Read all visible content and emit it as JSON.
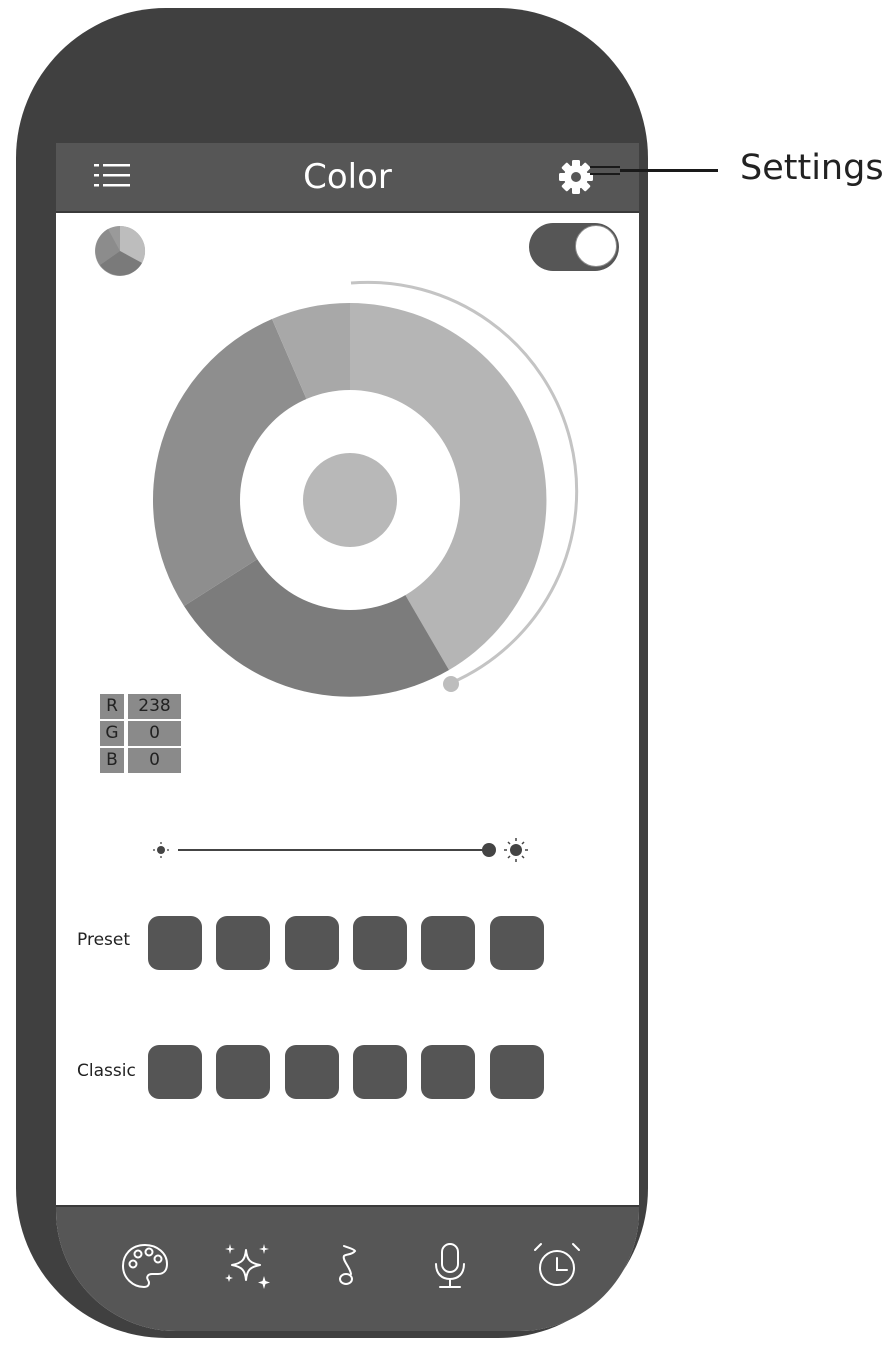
{
  "header": {
    "title": "Color"
  },
  "icons": {
    "menu": "list-menu-icon",
    "settings": "gear-icon",
    "tabs": [
      "palette-icon",
      "sparkles-icon",
      "music-note-icon",
      "microphone-icon",
      "alarm-clock-icon"
    ]
  },
  "power": {
    "state": "on"
  },
  "rgb": {
    "r_label": "R",
    "r": "238",
    "g_label": "G",
    "g": "0",
    "b_label": "B",
    "b": "0"
  },
  "brightness": {
    "level": 1.0
  },
  "presets": {
    "label": "Preset",
    "count": 6
  },
  "classics": {
    "label": "Classic",
    "count": 6
  },
  "callout": {
    "label": "Settings"
  },
  "colors": {
    "frame": "#404040",
    "bar": "#565656",
    "swatch": "#555555"
  }
}
